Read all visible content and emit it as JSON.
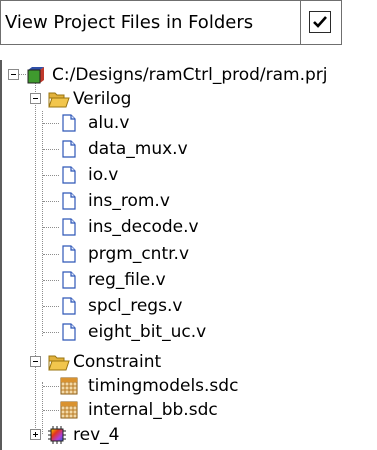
{
  "option": {
    "label": "View Project Files in Folders",
    "checked": true
  },
  "tree": {
    "project": {
      "label": "C:/Designs/ramCtrl_prod/ram.prj",
      "icon": "project-icon",
      "expanded": true
    },
    "verilog_folder": {
      "label": "Verilog",
      "icon": "open-folder-icon",
      "expanded": true,
      "files": [
        "alu.v",
        "data_mux.v",
        "io.v",
        "ins_rom.v",
        "ins_decode.v",
        "prgm_cntr.v",
        "reg_file.v",
        "spcl_regs.v",
        "eight_bit_uc.v"
      ]
    },
    "constraint_folder": {
      "label": "Constraint",
      "icon": "open-folder-icon",
      "expanded": true,
      "files": [
        "timingmodels.sdc",
        "internal_bb.sdc"
      ]
    },
    "implementation": {
      "label": "rev_4",
      "icon": "chip-icon",
      "expanded": false
    }
  },
  "colors": {
    "folder": "#f2c64d",
    "project_cube_red": "#c0392b",
    "project_cube_green": "#3f9a2e",
    "project_cube_blue": "#2f4fa8",
    "sdc_grid": "#c88a2a"
  }
}
